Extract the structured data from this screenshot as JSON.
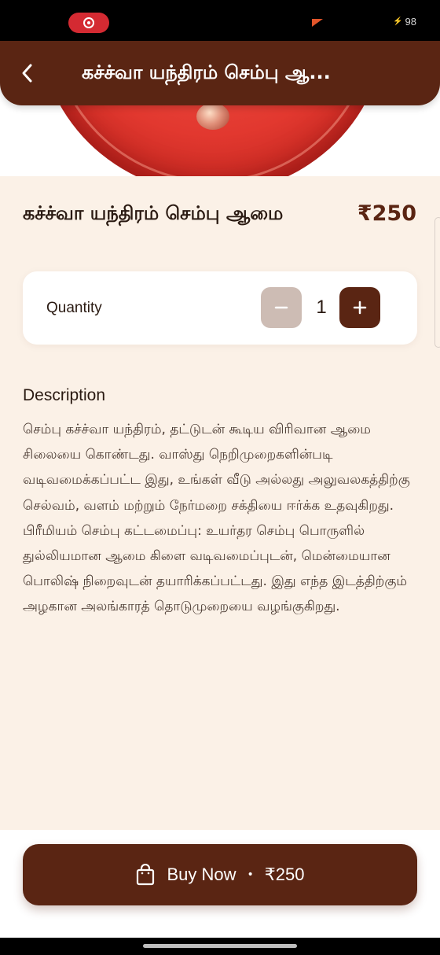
{
  "status_bar": {
    "battery_level": "98"
  },
  "header": {
    "title": "கச்ச்வா யந்திரம் செம்பு ஆ..."
  },
  "product": {
    "title": "கச்ச்வா யந்திரம் செம்பு ஆமை",
    "price": "₹250"
  },
  "quantity": {
    "label": "Quantity",
    "value": "1"
  },
  "description": {
    "heading": "Description",
    "body": "செம்பு கச்ச்வா யந்திரம், தட்டுடன் கூடிய விரிவான ஆமை சிலையை கொண்டது. வாஸ்து நெறிமுறைகளின்படி வடிவமைக்கப்பட்ட இது, உங்கள் வீடு அல்லது அலுவலகத்திற்கு செல்வம், வளம் மற்றும் நேர்மறை சக்தியை ஈர்க்க உதவுகிறது. பிரீமியம் செம்பு கட்டமைப்பு: உயர்தர செம்பு பொருளில் துல்லியமான ஆமை கிளை வடிவமைப்புடன், மென்மையான பொலிஷ் நிறைவுடன் தயாரிக்கப்பட்டது. இது எந்த இடத்திற்கும் அழகான அலங்காரத் தொடுமுறையை வழங்குகிறது."
  },
  "buy_button": {
    "label": "Buy Now",
    "separator": "•",
    "price": "₹250"
  },
  "colors": {
    "brand": "#5a2513",
    "background": "#fbf1e7",
    "minus_disabled": "#cdbcb4"
  },
  "icons": {
    "back": "chevron-left-icon",
    "bag": "shopping-bag-icon",
    "minus": "minus-icon",
    "plus": "plus-icon"
  }
}
